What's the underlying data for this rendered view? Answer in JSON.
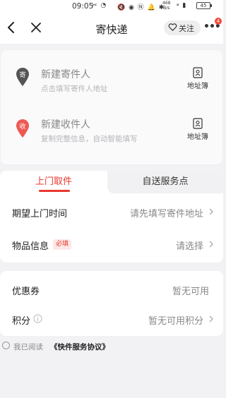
{
  "status_bar": {
    "time": "09:05",
    "left_icons": "✂ ◔",
    "right_icons": "🔇 ◉ Ⓝ 🔔 ✱",
    "network_speed": "468",
    "network_unit": "B/s",
    "signal": "⚬ ▮",
    "battery": "45"
  },
  "navbar": {
    "title": "寄快递",
    "follow_label": "关注",
    "more_label": "•••",
    "badge_count": "4"
  },
  "address": {
    "sender": {
      "pin_char": "寄",
      "pin_color": "#555555",
      "title": "新建寄件人",
      "hint": "点击填写寄件人地址",
      "book_label": "地址簿"
    },
    "receiver": {
      "pin_char": "收",
      "pin_color": "#ee5a52",
      "title": "新建收件人",
      "hint": "复制完整信息，自动智能填写",
      "book_label": "地址簿"
    }
  },
  "service": {
    "tabs": [
      {
        "label": "上门取件",
        "active": true
      },
      {
        "label": "自送服务点",
        "active": false
      }
    ],
    "rows": {
      "pickup_time": {
        "label": "期望上门时间",
        "value": "请先填写寄件地址"
      },
      "item_info": {
        "label": "物品信息",
        "required": "必填",
        "value": "请选择"
      }
    }
  },
  "benefits": {
    "coupon": {
      "label": "优惠券",
      "value": "暂无可用"
    },
    "points": {
      "label": "积分",
      "value": "暂无可用积分"
    }
  },
  "agreement": {
    "text": "我已阅读",
    "link": "《快件服务协议》"
  },
  "colors": {
    "accent": "#e8392e",
    "background": "#f2f2f5"
  }
}
